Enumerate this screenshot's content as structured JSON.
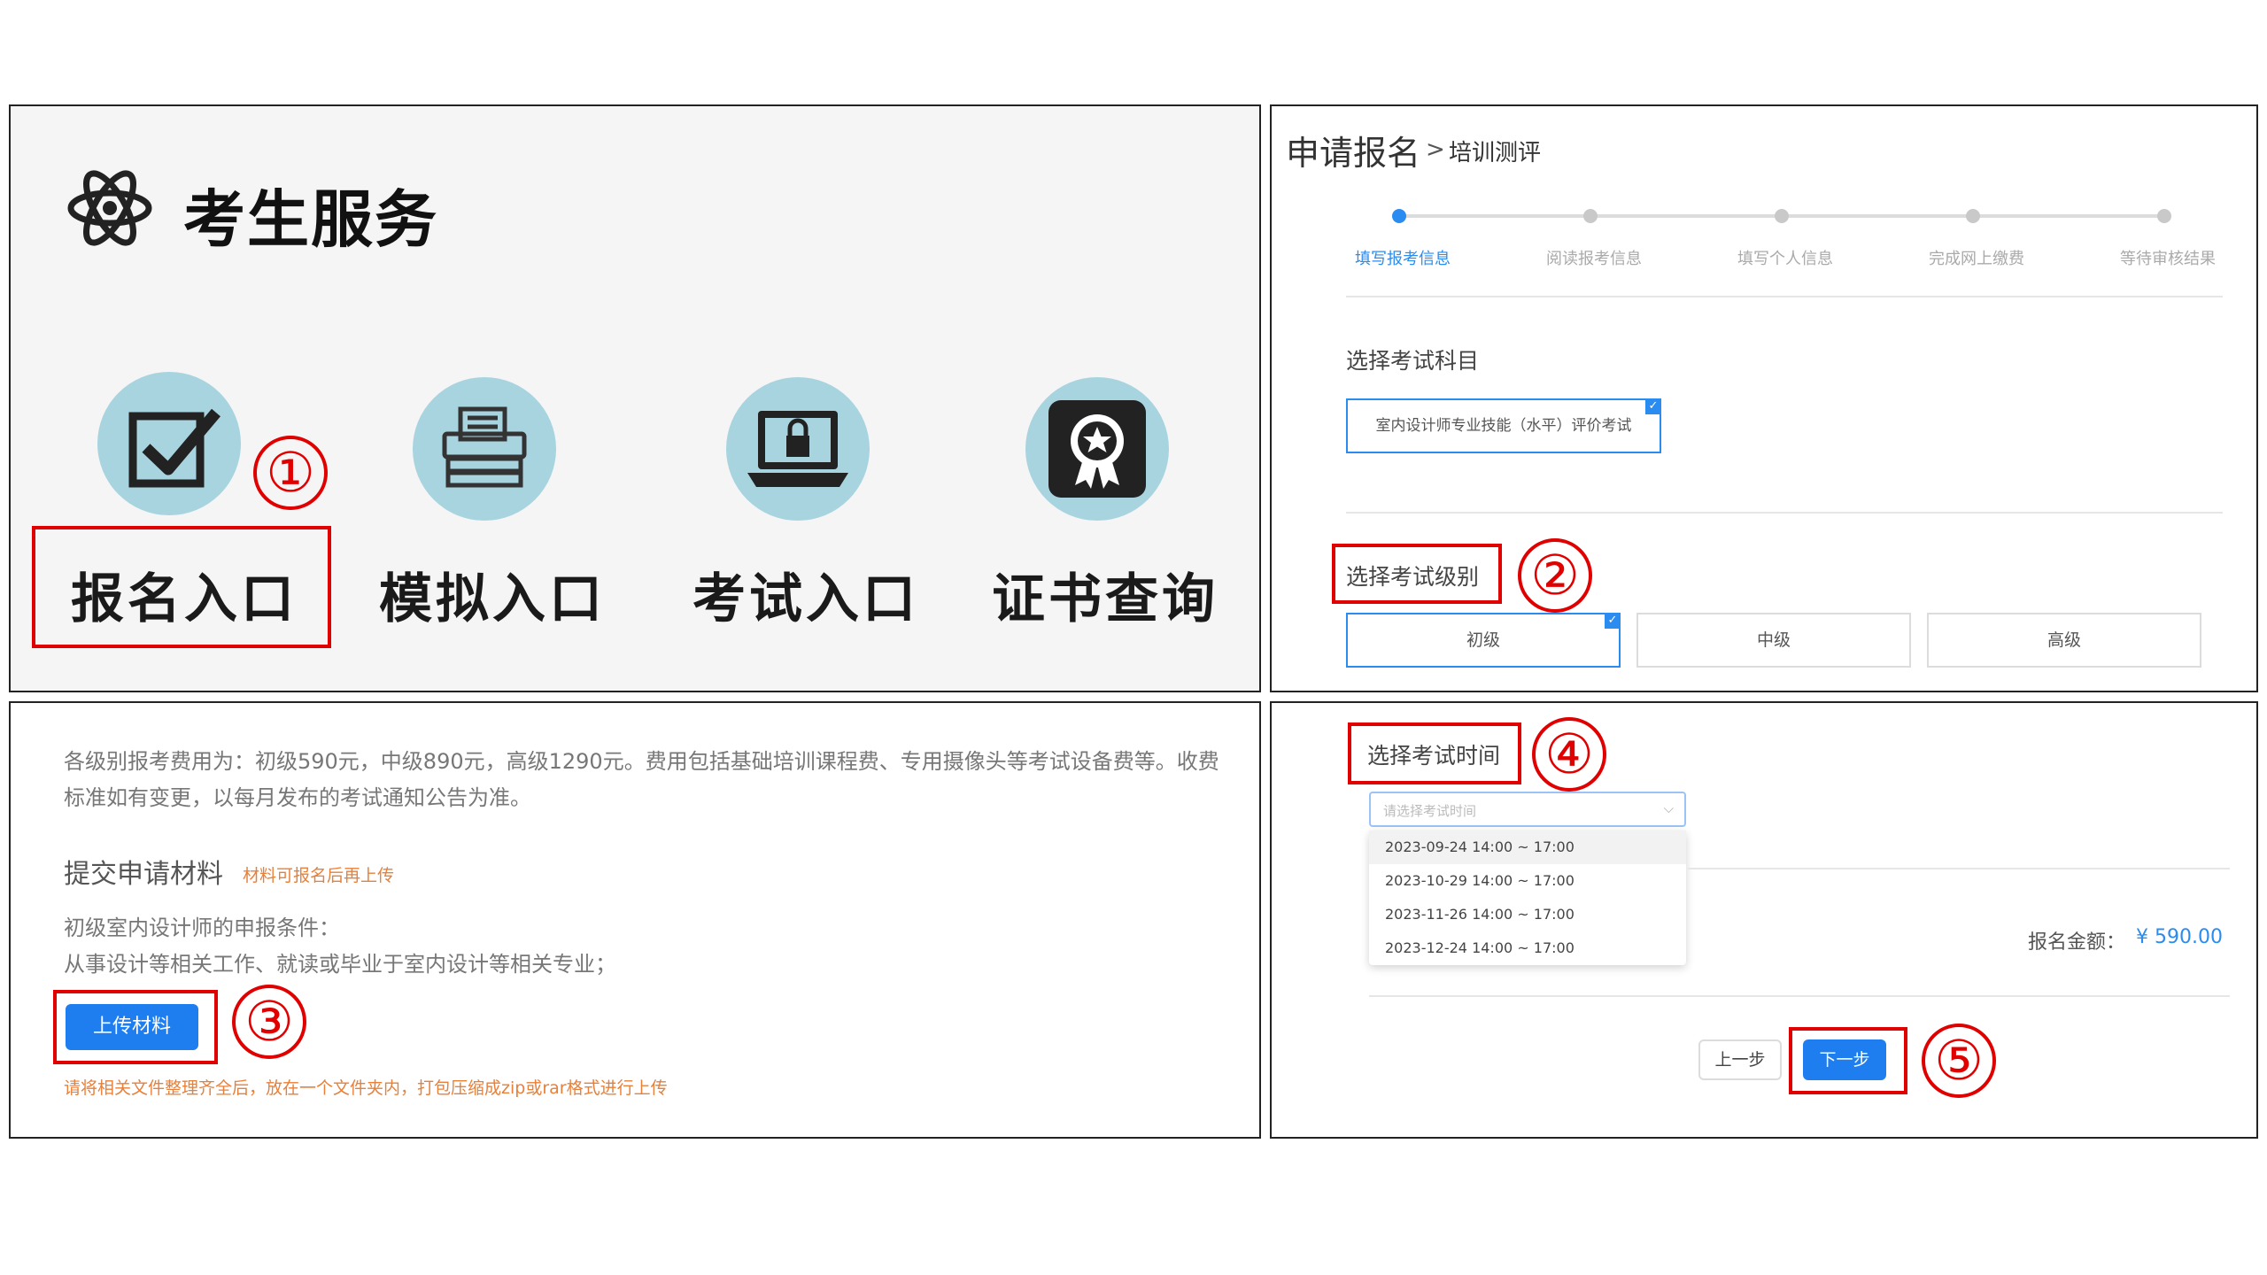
{
  "panel1": {
    "title": "考生服务",
    "atom_icon": "atom-icon",
    "entries": [
      {
        "label": "报名入口",
        "icon": "checkbox-icon"
      },
      {
        "label": "模拟入口",
        "icon": "typewriter-icon"
      },
      {
        "label": "考试入口",
        "icon": "laptop-lock-icon"
      },
      {
        "label": "证书查询",
        "icon": "certificate-badge-icon"
      }
    ],
    "step_marker": "①"
  },
  "panel2": {
    "breadcrumb_main": "申请报名",
    "breadcrumb_sep": ">",
    "breadcrumb_sub": "培训测评",
    "steps": [
      "填写报考信息",
      "阅读报考信息",
      "填写个人信息",
      "完成网上缴费",
      "等待审核结果"
    ],
    "active_step": 0,
    "subject_label": "选择考试科目",
    "subject_option": "室内设计师专业技能（水平）评价考试",
    "level_label": "选择考试级别",
    "levels": [
      "初级",
      "中级",
      "高级"
    ],
    "selected_level": 0,
    "step_marker": "②"
  },
  "panel3": {
    "fee_text": "各级别报考费用为：初级590元，中级890元，高级1290元。费用包括基础培训课程费、专用摄像头等考试设备费等。收费标准如有变更，以每月发布的考试通知公告为准。",
    "materials_title": "提交申请材料",
    "materials_note": "材料可报名后再上传",
    "condition_title": "初级室内设计师的申报条件：",
    "condition_text": "从事设计等相关工作、就读或毕业于室内设计等相关专业；",
    "upload_button": "上传材料",
    "upload_hint": "请将相关文件整理齐全后，放在一个文件夹内，打包压缩成zip或rar格式进行上传",
    "step_marker": "③"
  },
  "panel4": {
    "time_label": "选择考试时间",
    "select_placeholder": "请选择考试时间",
    "time_options": [
      "2023-09-24 14:00 ~ 17:00",
      "2023-10-29 14:00 ~ 17:00",
      "2023-11-26 14:00 ~ 17:00",
      "2023-12-24 14:00 ~ 17:00"
    ],
    "fee_label": "报名金额：",
    "fee_amount": "¥ 590.00",
    "prev_button": "上一步",
    "next_button": "下一步",
    "step_marker_time": "④",
    "step_marker_next": "⑤"
  },
  "colors": {
    "accent_blue": "#1e7ef0",
    "highlight_red": "#e00000",
    "note_orange": "#e8803a",
    "icon_circle": "#a8d4e0"
  }
}
